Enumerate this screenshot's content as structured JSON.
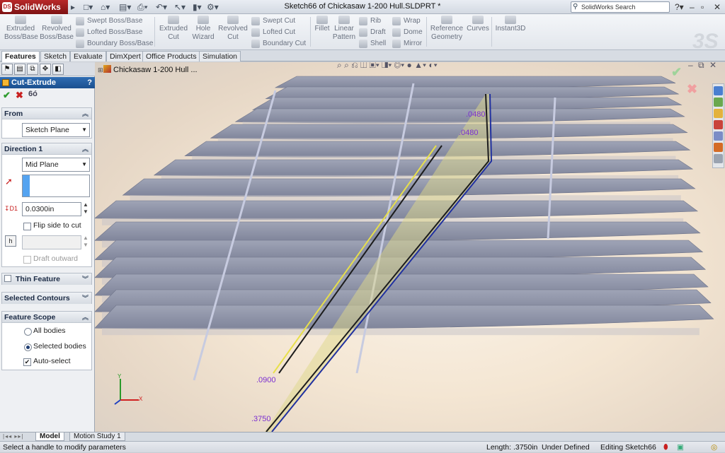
{
  "app": {
    "name": "SolidWorks",
    "window_title": "Sketch66 of Chickasaw 1-200 Hull.SLDPRT *",
    "search_placeholder": "SolidWorks Search"
  },
  "ribbon": {
    "large": [
      {
        "label1": "Extruded",
        "label2": "Boss/Base"
      },
      {
        "label1": "Revolved",
        "label2": "Boss/Base"
      },
      {
        "label1": "Extruded",
        "label2": "Cut"
      },
      {
        "label1": "Hole",
        "label2": "Wizard"
      },
      {
        "label1": "Revolved",
        "label2": "Cut"
      },
      {
        "label1": "Fillet",
        "label2": ""
      },
      {
        "label1": "Linear",
        "label2": "Pattern"
      },
      {
        "label1": "Reference",
        "label2": "Geometry"
      },
      {
        "label1": "Curves",
        "label2": ""
      },
      {
        "label1": "Instant3D",
        "label2": ""
      }
    ],
    "small": [
      "Swept Boss/Base",
      "Lofted Boss/Base",
      "Boundary Boss/Base",
      "Swept Cut",
      "Lofted Cut",
      "Boundary Cut",
      "Rib",
      "Draft",
      "Shell",
      "Wrap",
      "Dome",
      "Mirror"
    ]
  },
  "tabs": [
    "Features",
    "Sketch",
    "Evaluate",
    "DimXpert",
    "Office Products",
    "Simulation"
  ],
  "property_manager": {
    "title": "Cut-Extrude",
    "help": "?",
    "from": {
      "heading": "From",
      "value": "Sketch Plane"
    },
    "direction1": {
      "heading": "Direction 1",
      "end_condition": "Mid Plane",
      "depth": "0.0300in",
      "flip_label": "Flip side to cut",
      "draft_label": "Draft outward"
    },
    "thin_feature": "Thin Feature",
    "selected_contours": "Selected Contours",
    "feature_scope": {
      "heading": "Feature Scope",
      "option_all": "All bodies",
      "option_selected": "Selected bodies",
      "auto_select": "Auto-select"
    }
  },
  "tree": {
    "part_name": "Chickasaw 1-200 Hull ..."
  },
  "dimensions": [
    ".0480",
    ".0480",
    ".0900",
    ".3750"
  ],
  "bottom_tabs": [
    "Model",
    "Motion Study 1"
  ],
  "status": {
    "message": "Select a handle to modify parameters",
    "length": "Length: .3750in",
    "state": "Under Defined",
    "editing": "Editing Sketch66"
  }
}
